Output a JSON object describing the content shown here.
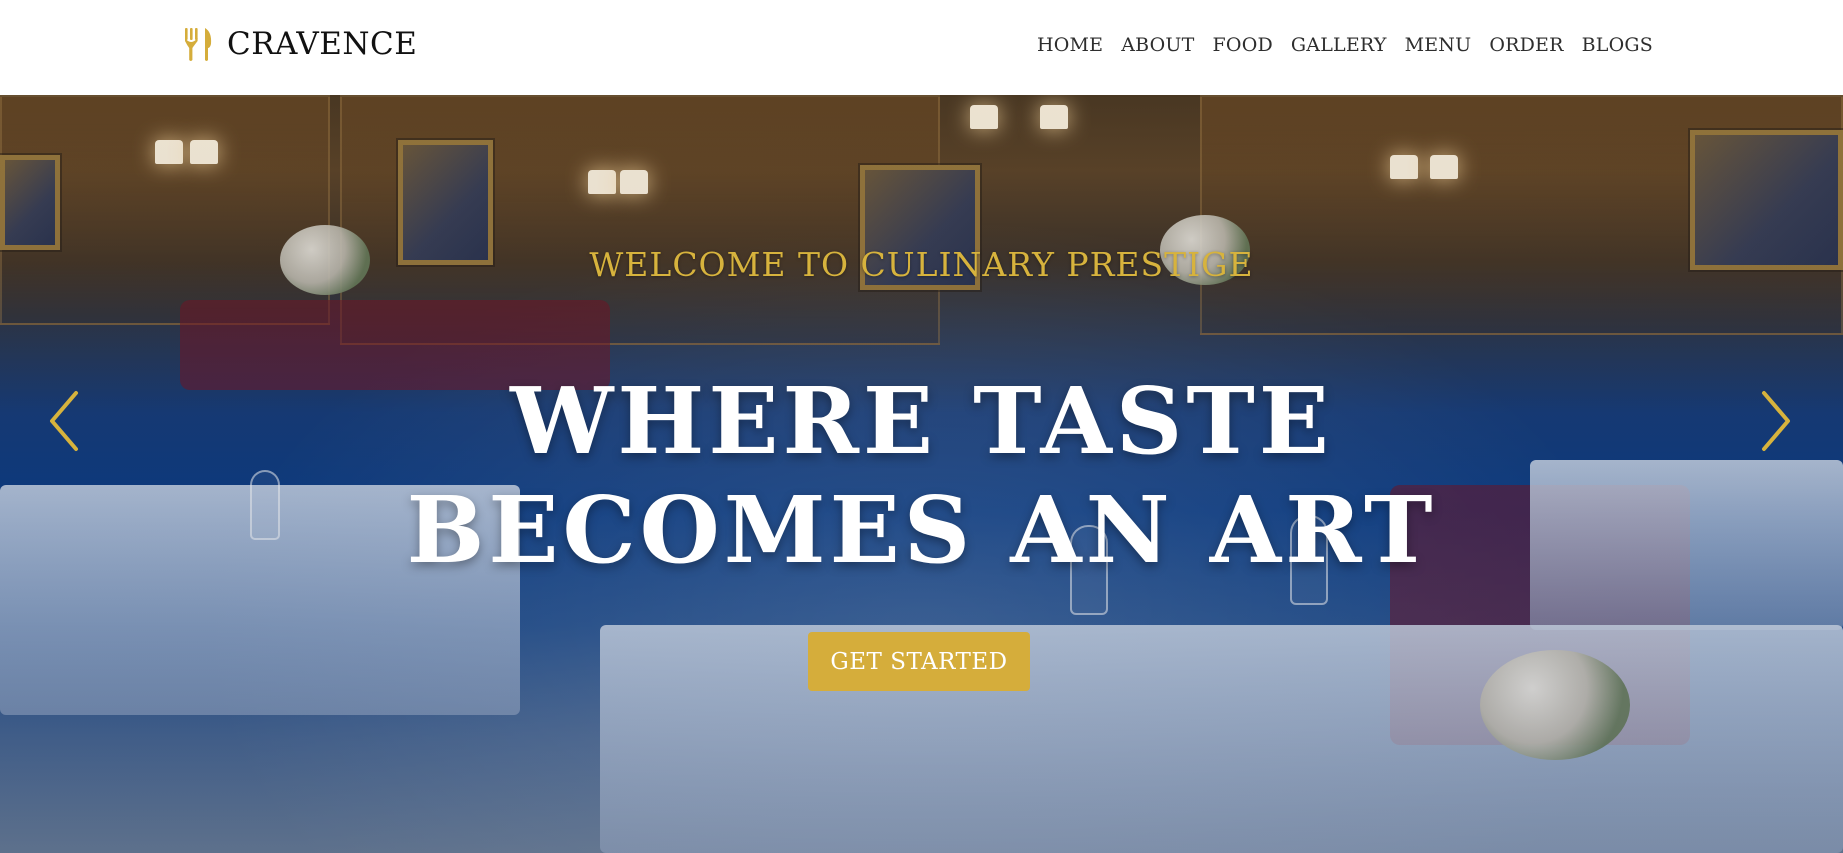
{
  "header": {
    "brand_name": "CRAVENCE",
    "brand_icon": "utensils-icon",
    "nav_items": [
      {
        "label": "HOME"
      },
      {
        "label": "ABOUT"
      },
      {
        "label": "FOOD"
      },
      {
        "label": "GALLERY"
      },
      {
        "label": "MENU"
      },
      {
        "label": "ORDER"
      },
      {
        "label": "BLOGS"
      }
    ]
  },
  "hero": {
    "kicker": "WELCOME TO CULINARY PRESTIGE",
    "title_line_1": "WHERE TASTE",
    "title_line_2": "BECOMES AN ART",
    "cta_label": "GET STARTED",
    "prev_icon": "chevron-left-icon",
    "next_icon": "chevron-right-icon"
  },
  "colors": {
    "accent": "#d5ad3b",
    "kicker": "#d7b33d",
    "nav_text": "#2e2e2e",
    "brand_text": "#111111",
    "hero_title": "#ffffff"
  }
}
